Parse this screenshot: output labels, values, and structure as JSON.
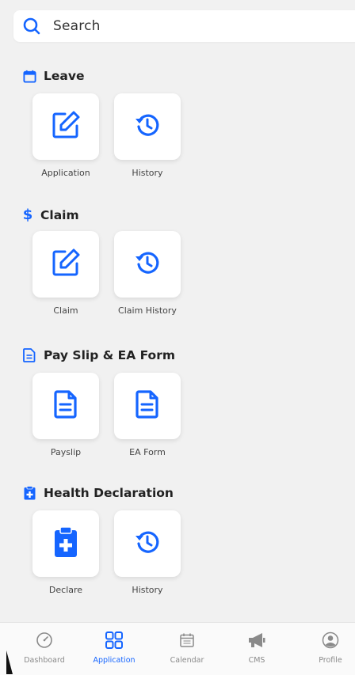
{
  "search": {
    "placeholder": "Search"
  },
  "sections": [
    {
      "title": "Leave",
      "icon": "calendar-icon",
      "items": [
        {
          "label": "Application",
          "icon": "edit-icon"
        },
        {
          "label": "History",
          "icon": "history-icon"
        }
      ]
    },
    {
      "title": "Claim",
      "icon": "dollar-icon",
      "items": [
        {
          "label": "Claim",
          "icon": "edit-icon"
        },
        {
          "label": "Claim History",
          "icon": "history-icon"
        }
      ]
    },
    {
      "title": "Pay Slip & EA Form",
      "icon": "document-icon",
      "items": [
        {
          "label": "Payslip",
          "icon": "document-icon"
        },
        {
          "label": "EA Form",
          "icon": "document-icon"
        }
      ]
    },
    {
      "title": "Health Declaration",
      "icon": "clipboard-medical-icon",
      "items": [
        {
          "label": "Declare",
          "icon": "clipboard-medical-icon"
        },
        {
          "label": "History",
          "icon": "history-icon"
        }
      ]
    }
  ],
  "tabbar": {
    "items": [
      {
        "label": "Dashboard",
        "icon": "gauge-icon",
        "active": false
      },
      {
        "label": "Application",
        "icon": "grid-icon",
        "active": true
      },
      {
        "label": "Calendar",
        "icon": "calendar-icon",
        "active": false
      },
      {
        "label": "CMS",
        "icon": "megaphone-icon",
        "active": false
      },
      {
        "label": "Profile",
        "icon": "user-circle-icon",
        "active": false
      }
    ]
  },
  "colors": {
    "accent": "#1565ff",
    "background": "#f1f1f1",
    "tile": "#ffffff",
    "inactive": "#8a8a8a"
  }
}
